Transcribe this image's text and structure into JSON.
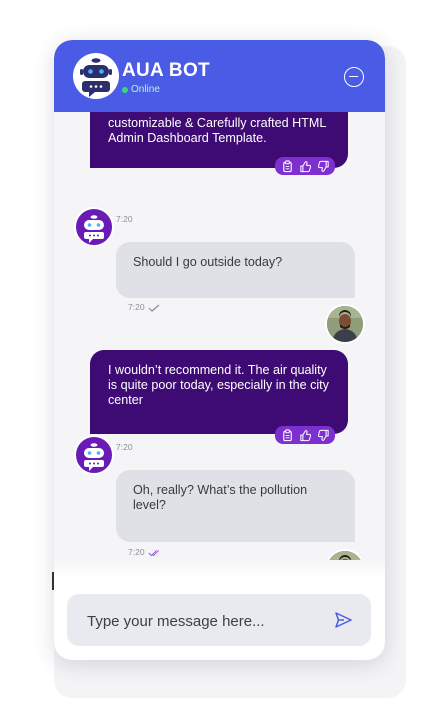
{
  "header": {
    "title": "AUA BOT",
    "status": "Online",
    "icons": {
      "logo": "bot-logo-icon",
      "minimize": "minimize-circle-icon"
    }
  },
  "messages": [
    {
      "sender": "bot",
      "text": "customizable & Carefully crafted HTML Admin Dashboard Template.",
      "time": "7:20",
      "reactions": [
        "copy-icon",
        "thumbs-up-icon",
        "thumbs-down-icon"
      ]
    },
    {
      "sender": "user",
      "text": "Should I go outside today?",
      "time": "7:20",
      "receipt": "single-check-icon"
    },
    {
      "sender": "bot",
      "text": "I wouldn’t recommend it. The air quality is quite poor today, especially in the city center",
      "time": "7:20",
      "reactions": [
        "copy-icon",
        "thumbs-up-icon",
        "thumbs-down-icon"
      ]
    },
    {
      "sender": "user",
      "text": "Oh, really? What’s the pollution level?",
      "time": "7:20",
      "receipt": "double-check-icon"
    }
  ],
  "composer": {
    "placeholder": "Type your message here...",
    "send_icon": "send-icon"
  },
  "colors": {
    "header": "#4a5be6",
    "bot_bubble": "#3e0b74",
    "user_bubble": "#dfe1e6",
    "reaction_bar": "#7d2fd0",
    "online": "#34d97b"
  }
}
